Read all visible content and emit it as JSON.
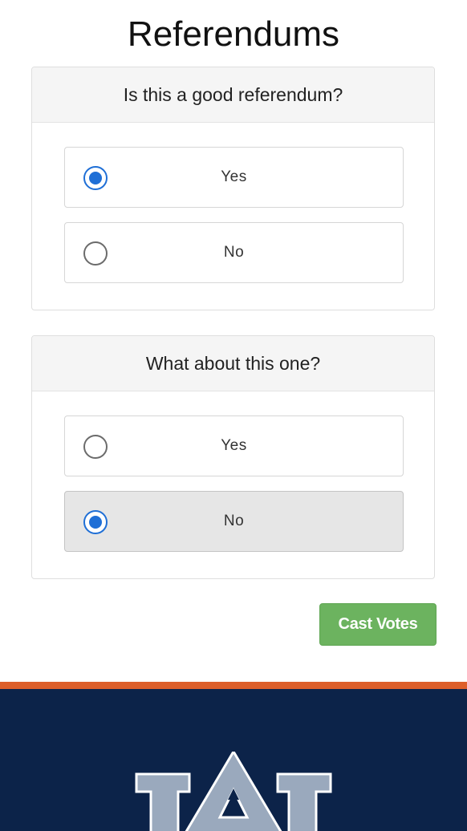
{
  "page": {
    "title": "Referendums"
  },
  "referendums": [
    {
      "question": "Is this a good referendum?",
      "options": [
        {
          "label": "Yes",
          "selected": true
        },
        {
          "label": "No",
          "selected": false
        }
      ]
    },
    {
      "question": "What about this one?",
      "options": [
        {
          "label": "Yes",
          "selected": false
        },
        {
          "label": "No",
          "selected": true
        }
      ]
    }
  ],
  "actions": {
    "cast_label": "Cast Votes"
  },
  "footer": {
    "logo_icon": "university-au-logo",
    "logo_text": "AU"
  },
  "colors": {
    "accent_blue": "#1f6fd6",
    "button_green": "#6cb35f",
    "footer_navy": "#0c2349",
    "footer_orange": "#dd5f2a",
    "logo_gray": "#9aa9bd"
  }
}
